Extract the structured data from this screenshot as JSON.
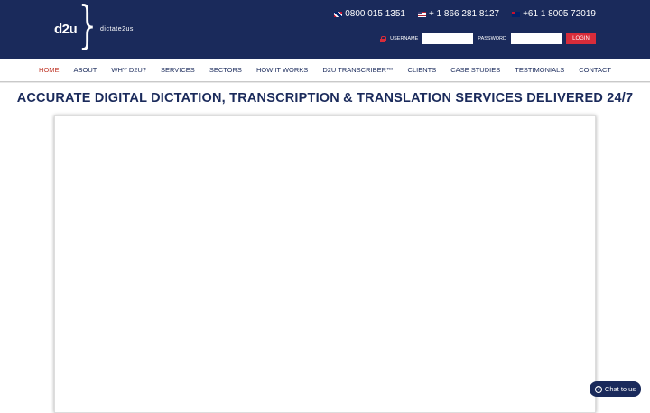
{
  "header": {
    "logo": {
      "mark": "d2u",
      "brace": "}",
      "text": "dictate2us"
    },
    "phones": [
      {
        "flag": "uk-flag-icon",
        "number": "0800 015 1351"
      },
      {
        "flag": "us-flag-icon",
        "number": "+ 1 866 281 8127"
      },
      {
        "flag": "au-flag-icon",
        "number": "+61 1 8005 72019"
      }
    ],
    "login": {
      "username_label": "USERNAME",
      "password_label": "PASSWORD",
      "username_value": "",
      "password_value": "",
      "button_label": "LOGIN"
    }
  },
  "nav": {
    "items": [
      {
        "label": "HOME",
        "active": true
      },
      {
        "label": "ABOUT"
      },
      {
        "label": "WHY D2U?"
      },
      {
        "label": "SERVICES"
      },
      {
        "label": "SECTORS"
      },
      {
        "label": "HOW IT WORKS"
      },
      {
        "label": "D2U TRANSCRIBER™"
      },
      {
        "label": "CLIENTS"
      },
      {
        "label": "CASE STUDIES"
      },
      {
        "label": "TESTIMONIALS"
      },
      {
        "label": "CONTACT"
      }
    ]
  },
  "main": {
    "headline": "ACCURATE DIGITAL DICTATION, TRANSCRIPTION & TRANSLATION SERVICES DELIVERED 24/7"
  },
  "chat": {
    "icon": "?",
    "label": "Chat to us"
  },
  "colors": {
    "navy": "#1a2a5b",
    "accent_red": "#d82c3a",
    "active_nav": "#c0392b"
  }
}
